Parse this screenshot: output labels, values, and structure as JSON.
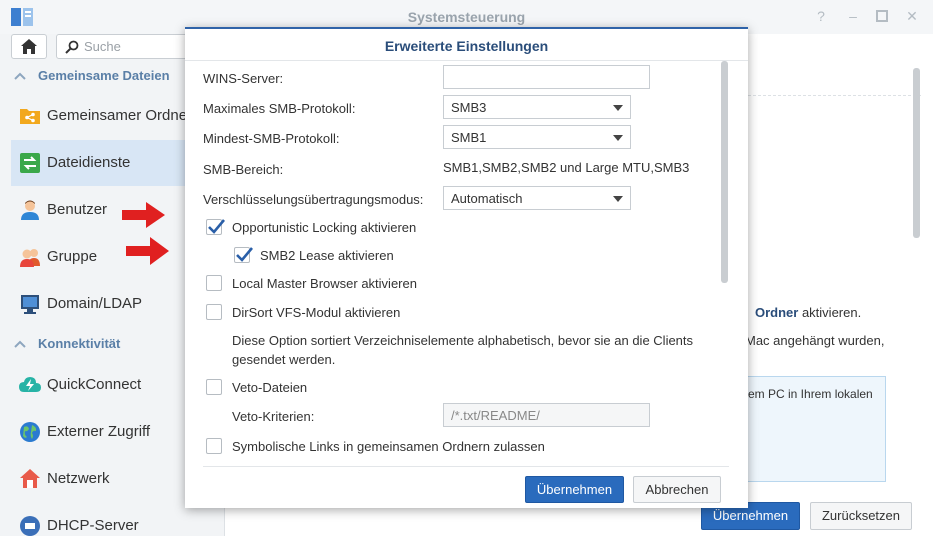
{
  "window": {
    "title": "Systemsteuerung",
    "controls": [
      "help-icon",
      "pin-icon",
      "maximize-icon",
      "close-icon"
    ]
  },
  "sidebar": {
    "search_placeholder": "Suche",
    "sections": [
      {
        "label": "Gemeinsame Dateien",
        "items": [
          {
            "label": "Gemeinsamer Ordner",
            "icon": "shared-folder-icon",
            "active": false
          },
          {
            "label": "Dateidienste",
            "icon": "file-services-icon",
            "active": true
          },
          {
            "label": "Benutzer",
            "icon": "user-icon",
            "active": false
          },
          {
            "label": "Gruppe",
            "icon": "group-icon",
            "active": false
          },
          {
            "label": "Domain/LDAP",
            "icon": "domain-icon",
            "active": false
          }
        ]
      },
      {
        "label": "Konnektivität",
        "items": [
          {
            "label": "QuickConnect",
            "icon": "quickconnect-icon",
            "active": false
          },
          {
            "label": "Externer Zugriff",
            "icon": "globe-icon",
            "active": false
          },
          {
            "label": "Netzwerk",
            "icon": "network-icon",
            "active": false
          },
          {
            "label": "DHCP-Server",
            "icon": "dhcp-icon",
            "active": false
          }
        ]
      }
    ]
  },
  "background": {
    "text_line1_bold": "Ordner",
    "text_line1_rest": " aktivieren.",
    "text_line2": "Mac angehängt wurden,",
    "text_line3": "em PC in Ihrem lokalen",
    "apply_label": "Übernehmen",
    "reset_label": "Zurücksetzen"
  },
  "dialog": {
    "title": "Erweiterte Einstellungen",
    "wins_server": {
      "label": "WINS-Server:",
      "value": ""
    },
    "max_smb": {
      "label": "Maximales SMB-Protokoll:",
      "value": "SMB3"
    },
    "min_smb": {
      "label": "Mindest-SMB-Protokoll:",
      "value": "SMB1"
    },
    "smb_range": {
      "label": "SMB-Bereich:",
      "value": "SMB1,SMB2,SMB2 und Large MTU,SMB3"
    },
    "encryption": {
      "label": "Verschlüsselungsübertragungsmodus:",
      "value": "Automatisch"
    },
    "checkboxes": {
      "oplock": {
        "label": "Opportunistic Locking aktivieren",
        "checked": true
      },
      "smb2_lease": {
        "label": "SMB2 Lease aktivieren",
        "checked": true
      },
      "local_master": {
        "label": "Local Master Browser aktivieren",
        "checked": false
      },
      "dirsort": {
        "label": "DirSort VFS-Modul aktivieren",
        "checked": false
      },
      "veto": {
        "label": "Veto-Dateien",
        "checked": false
      },
      "symlinks": {
        "label": "Symbolische Links in gemeinsamen Ordnern zulassen",
        "checked": false
      }
    },
    "dirsort_description": "Diese Option sortiert Verzeichniselemente alphabetisch, bevor sie an die Clients gesendet werden.",
    "veto_criteria": {
      "label": "Veto-Kriterien:",
      "value": "/*.txt/README/"
    },
    "apply_label": "Übernehmen",
    "cancel_label": "Abbrechen"
  },
  "colors": {
    "accent": "#2a6bbd",
    "section_header": "#5a7fa7",
    "active_item": "#d8e6f5",
    "annotation_arrow": "#e02020"
  }
}
